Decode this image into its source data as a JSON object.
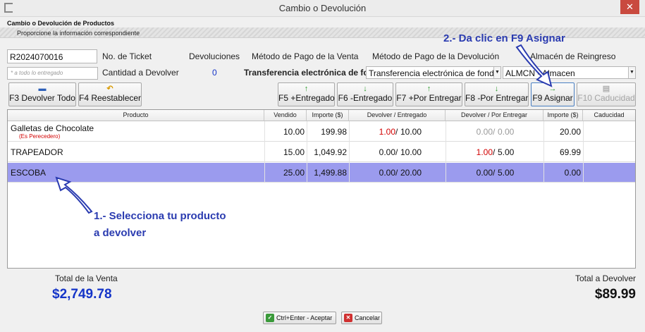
{
  "window": {
    "title": "Cambio o Devolución",
    "close_glyph": "✕"
  },
  "header": {
    "title": "Cambio o Devolución de Productos",
    "subtitle": "Proporcione la información correspondiente"
  },
  "form": {
    "ticket_value": "R2024070016",
    "ticket_label": "No. de Ticket",
    "devoluciones_label": "Devoluciones",
    "devoluciones_value": "0",
    "metodo_venta_label": "Método de Pago de la Venta",
    "metodo_venta_value": "Transferencia electrónica de fondos",
    "metodo_devolucion_label": "Método de Pago de la Devolución",
    "metodo_devolucion_value": "Transferencia electrónica de fondos",
    "almacen_label": "Almacén de Reingreso",
    "almacen_value": "ALMCN - Almacen",
    "cantidad_placeholder": "* a todo lo entregado",
    "cantidad_label": "Cantidad a Devolver"
  },
  "toolbar": {
    "devolver_todo": {
      "icon": "minus-icon",
      "label": "F3 Devolver Todo"
    },
    "reestablecer": {
      "icon": "undo-arrow-icon",
      "label": "F4 Reestablecer"
    },
    "entregado_plus": {
      "icon": "arrow-up-icon",
      "label": "F5 +Entregado"
    },
    "entregado_minus": {
      "icon": "arrow-down-icon",
      "label": "F6 -Entregado"
    },
    "por_entregar_plus": {
      "icon": "arrow-up-icon",
      "label": "F7 +Por Entregar"
    },
    "por_entregar_minus": {
      "icon": "arrow-down-icon",
      "label": "F8 -Por Entregar"
    },
    "asignar": {
      "icon": "arrow-right-icon",
      "label": "F9 Asignar"
    },
    "caducidad": {
      "icon": "calendar-icon",
      "label": "F10 Caducidad"
    }
  },
  "grid": {
    "columns": [
      "Producto",
      "Vendido",
      "Importe ($)",
      "Devolver / Entregado",
      "Devolver / Por Entregar",
      "Importe ($)",
      "Caducidad"
    ],
    "rows": [
      {
        "producto": "Galletas de Chocolate",
        "nota": "(Es Perecedero)",
        "vendido": "10.00",
        "importe": "199.98",
        "dev_ent": "1.00",
        "ent": "10.00",
        "dev_por": "0.00",
        "por": "0.00",
        "importe_dev": "20.00",
        "caducidad": ""
      },
      {
        "producto": "TRAPEADOR",
        "nota": "",
        "vendido": "15.00",
        "importe": "1,049.92",
        "dev_ent": "0.00",
        "ent": "10.00",
        "dev_por": "1.00",
        "por": "5.00",
        "importe_dev": "69.99",
        "caducidad": ""
      },
      {
        "producto": "ESCOBA",
        "nota": "",
        "vendido": "25.00",
        "importe": "1,499.88",
        "dev_ent": "0.00",
        "ent": "20.00",
        "dev_por": "0.00",
        "por": "5.00",
        "importe_dev": "0.00",
        "caducidad": ""
      }
    ],
    "separator": "/"
  },
  "footer": {
    "total_venta_label": "Total de la Venta",
    "total_venta_value": "$2,749.78",
    "total_devolver_label": "Total a Devolver",
    "total_devolver_value": "$89.99",
    "aceptar_label": "Ctrl+Enter - Aceptar",
    "cancelar_label": "Cancelar"
  },
  "annotations": {
    "step1_line1": "1.- Selecciona tu producto",
    "step1_line2": "a devolver",
    "step2": "2.- Da clic en F9 Asignar"
  },
  "colors": {
    "selected_row": "#9b9bee",
    "accent_blue": "#1434c8",
    "red_value": "#d20000",
    "close_red": "#c94a3f"
  }
}
